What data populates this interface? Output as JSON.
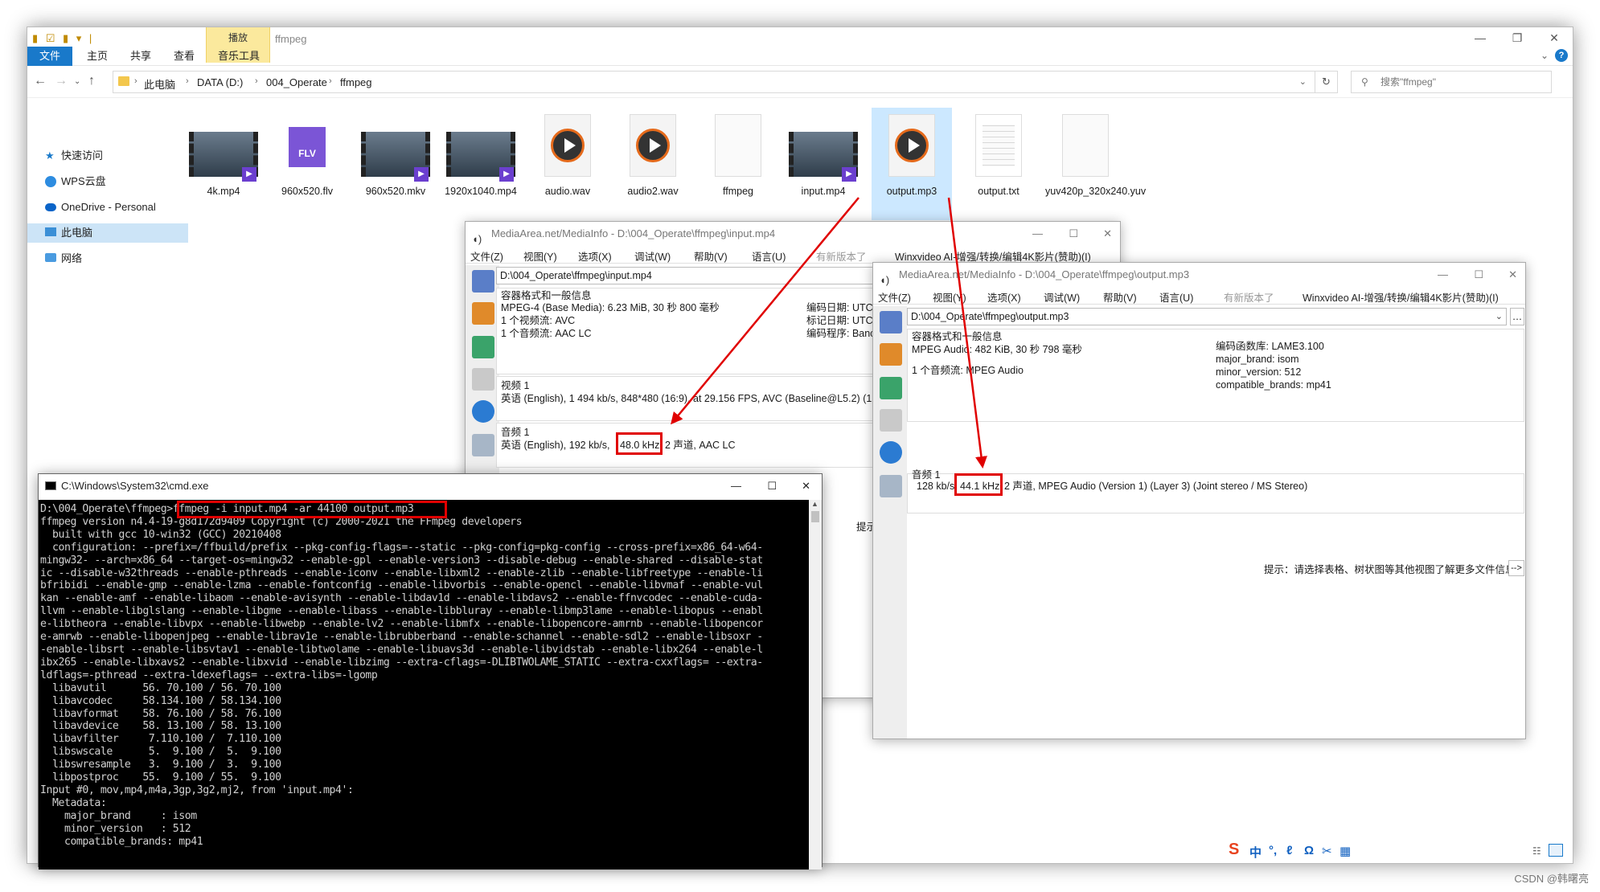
{
  "explorer": {
    "title": "ffmpeg",
    "context_tab": "播放",
    "tabs": [
      "文件",
      "主页",
      "共享",
      "查看",
      "音乐工具"
    ],
    "breadcrumb": [
      "此电脑",
      "DATA (D:)",
      "004_Operate",
      "ffmpeg"
    ],
    "search_placeholder": "搜索\"ffmpeg\"",
    "sidebar": [
      "快速访问",
      "WPS云盘",
      "OneDrive - Personal",
      "此电脑",
      "网络"
    ],
    "files": [
      {
        "name": "4k.mp4",
        "kind": "video-thumb"
      },
      {
        "name": "960x520.flv",
        "kind": "flv"
      },
      {
        "name": "960x520.mkv",
        "kind": "video-thumb"
      },
      {
        "name": "1920x1040.mp4",
        "kind": "video-thumb"
      },
      {
        "name": "audio.wav",
        "kind": "media-play"
      },
      {
        "name": "audio2.wav",
        "kind": "media-play"
      },
      {
        "name": "ffmpeg",
        "kind": "blank"
      },
      {
        "name": "input.mp4",
        "kind": "video-thumb"
      },
      {
        "name": "output.mp3",
        "kind": "media-play",
        "selected": true
      },
      {
        "name": "output.txt",
        "kind": "text"
      },
      {
        "name": "yuv420p_320x240.yuv",
        "kind": "blank"
      }
    ]
  },
  "mediainfo_input": {
    "title": "MediaArea.net/MediaInfo - D:\\004_Operate\\ffmpeg\\input.mp4",
    "menu": [
      "文件(Z)",
      "视图(Y)",
      "选项(X)",
      "调试(W)",
      "帮助(V)",
      "语言(U)",
      "有新版本了",
      "Winxvideo AI-增强/转换/编辑4K影片(赞助)(I)"
    ],
    "path": "D:\\004_Operate\\ffmpeg\\input.mp4",
    "general_heading": "容器格式和一般信息",
    "general_line1": "MPEG-4 (Base Media): 6.23 MiB, 30 秒 800 毫秒",
    "general_line2": "1 个视频流: AVC",
    "general_line3": "1 个音频流: AAC LC",
    "meta_1": "编码日期: UTC",
    "meta_2": "标记日期: UTC",
    "meta_3": "编码程序: Banc",
    "video_heading": "视频 1",
    "video_line": "英语 (English), 1 494 kb/s, 848*480 (16:9), at 29.156 FPS, AVC (Baseline@L5.2) (1",
    "audio_heading": "音频 1",
    "audio_prefix": "英语 (English), 192 kb/s,",
    "audio_rate": "48.0 kHz,",
    "audio_suffix": "2 声道, AAC LC",
    "hint": "提示"
  },
  "mediainfo_output": {
    "title": "MediaArea.net/MediaInfo - D:\\004_Operate\\ffmpeg\\output.mp3",
    "menu": [
      "文件(Z)",
      "视图(Y)",
      "选项(X)",
      "调试(W)",
      "帮助(V)",
      "语言(U)",
      "有新版本了",
      "Winxvideo AI-增强/转换/编辑4K影片(赞助)(I)"
    ],
    "path": "D:\\004_Operate\\ffmpeg\\output.mp3",
    "general_heading": "容器格式和一般信息",
    "general_line1": "MPEG Audio: 482 KiB, 30 秒 798 毫秒",
    "general_line2": "1 个音频流: MPEG Audio",
    "meta_1": "编码函数库: LAME3.100",
    "meta_2": "major_brand: isom",
    "meta_3": "minor_version: 512",
    "meta_4": "compatible_brands: mp41",
    "audio_heading": "音频 1",
    "audio_prefix": "128 kb/s,",
    "audio_rate": "44.1 kHz,",
    "audio_suffix": "2 声道, MPEG Audio (Version 1) (Layer 3) (Joint stereo / MS Stereo)",
    "hint": "提示：请选择表格、树状图等其他视图了解更多文件信息",
    "hint_button": "-->"
  },
  "cmd": {
    "title": "C:\\Windows\\System32\\cmd.exe",
    "prompt": "D:\\004_Operate\\ffmpeg>",
    "command": "ffmpeg -i input.mp4 -ar 44100 output.mp3",
    "lines": [
      "ffmpeg version n4.4-19-g8d172d9409 Copyright (c) 2000-2021 the FFmpeg developers",
      "  built with gcc 10-win32 (GCC) 20210408",
      "  configuration: --prefix=/ffbuild/prefix --pkg-config-flags=--static --pkg-config=pkg-config --cross-prefix=x86_64-w64-",
      "mingw32- --arch=x86_64 --target-os=mingw32 --enable-gpl --enable-version3 --disable-debug --enable-shared --disable-stat",
      "ic --disable-w32threads --enable-pthreads --enable-iconv --enable-libxml2 --enable-zlib --enable-libfreetype --enable-li",
      "bfribidi --enable-gmp --enable-lzma --enable-fontconfig --enable-libvorbis --enable-opencl --enable-libvmaf --enable-vul",
      "kan --enable-amf --enable-libaom --enable-avisynth --enable-libdav1d --enable-libdavs2 --enable-ffnvcodec --enable-cuda-",
      "llvm --enable-libglslang --enable-libgme --enable-libass --enable-libbluray --enable-libmp3lame --enable-libopus --enabl",
      "e-libtheora --enable-libvpx --enable-libwebp --enable-lv2 --enable-libmfx --enable-libopencore-amrnb --enable-libopencor",
      "e-amrwb --enable-libopenjpeg --enable-librav1e --enable-librubberband --enable-schannel --enable-sdl2 --enable-libsoxr -",
      "-enable-libsrt --enable-libsvtav1 --enable-libtwolame --enable-libuavs3d --enable-libvidstab --enable-libx264 --enable-l",
      "ibx265 --enable-libxavs2 --enable-libxvid --enable-libzimg --extra-cflags=-DLIBTWOLAME_STATIC --extra-cxxflags= --extra-",
      "ldflags=-pthread --extra-ldexeflags= --extra-libs=-lgomp",
      "  libavutil      56. 70.100 / 56. 70.100",
      "  libavcodec     58.134.100 / 58.134.100",
      "  libavformat    58. 76.100 / 58. 76.100",
      "  libavdevice    58. 13.100 / 58. 13.100",
      "  libavfilter     7.110.100 /  7.110.100",
      "  libswscale      5.  9.100 /  5.  9.100",
      "  libswresample   3.  9.100 /  3.  9.100",
      "  libpostproc    55.  9.100 / 55.  9.100",
      "Input #0, mov,mp4,m4a,3gp,3g2,mj2, from 'input.mp4':",
      "  Metadata:",
      "    major_brand     : isom",
      "    minor_version   : 512",
      "    compatible_brands: mp41"
    ]
  },
  "tray": [
    "中",
    "°,",
    "ℓ",
    "Ω",
    "✂",
    "▦"
  ],
  "watermark": "CSDN @韩曙亮",
  "colors": {
    "accent": "#1979ca",
    "context_tab": "#fbe99d",
    "highlight": "#e00000",
    "selection": "#cce8ff"
  }
}
